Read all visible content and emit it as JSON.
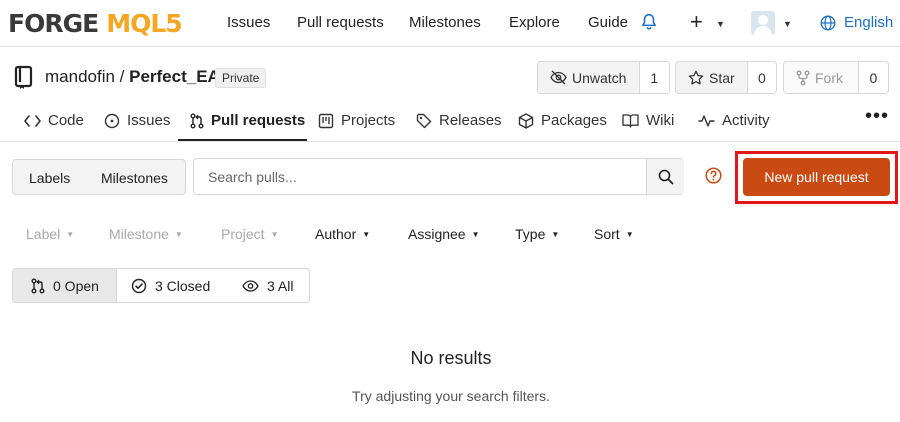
{
  "logo": {
    "part1": "FORGE",
    "part2": "MQL5"
  },
  "nav": {
    "issues": "Issues",
    "pull_requests": "Pull requests",
    "milestones": "Milestones",
    "explore": "Explore",
    "guide": "Guide",
    "language": "English"
  },
  "repo": {
    "owner": "mandofin",
    "separator": " / ",
    "name": "Perfect_EA",
    "visibility": "Private",
    "unwatch_label": "Unwatch",
    "watch_count": "1",
    "star_label": "Star",
    "star_count": "0",
    "fork_label": "Fork",
    "fork_count": "0"
  },
  "tabs": {
    "code": "Code",
    "issues": "Issues",
    "pull_requests": "Pull requests",
    "projects": "Projects",
    "releases": "Releases",
    "packages": "Packages",
    "wiki": "Wiki",
    "activity": "Activity",
    "more": "•••"
  },
  "filters": {
    "labels": "Labels",
    "milestones": "Milestones",
    "search_placeholder": "Search pulls...",
    "new_pr": "New pull request",
    "label": "Label",
    "milestone": "Milestone",
    "project": "Project",
    "author": "Author",
    "assignee": "Assignee",
    "type": "Type",
    "sort": "Sort"
  },
  "states": {
    "open": "0 Open",
    "closed": "3 Closed",
    "all": "3 All"
  },
  "empty": {
    "title": "No results",
    "subtitle": "Try adjusting your search filters."
  },
  "colors": {
    "accent_button": "#c94a13",
    "highlight_box": "#e2141c",
    "logo_orange": "#f5a623",
    "link_blue": "#1f6fc5"
  },
  "icons": [
    "bell-icon",
    "plus-icon",
    "avatar",
    "globe-icon",
    "repo-icon",
    "eye-slash-icon",
    "star-icon",
    "fork-icon",
    "code-icon",
    "issue-icon",
    "pull-request-icon",
    "project-icon",
    "tag-icon",
    "package-icon",
    "book-icon",
    "pulse-icon",
    "search-icon",
    "question-icon",
    "check-circle-icon",
    "eye-icon"
  ]
}
